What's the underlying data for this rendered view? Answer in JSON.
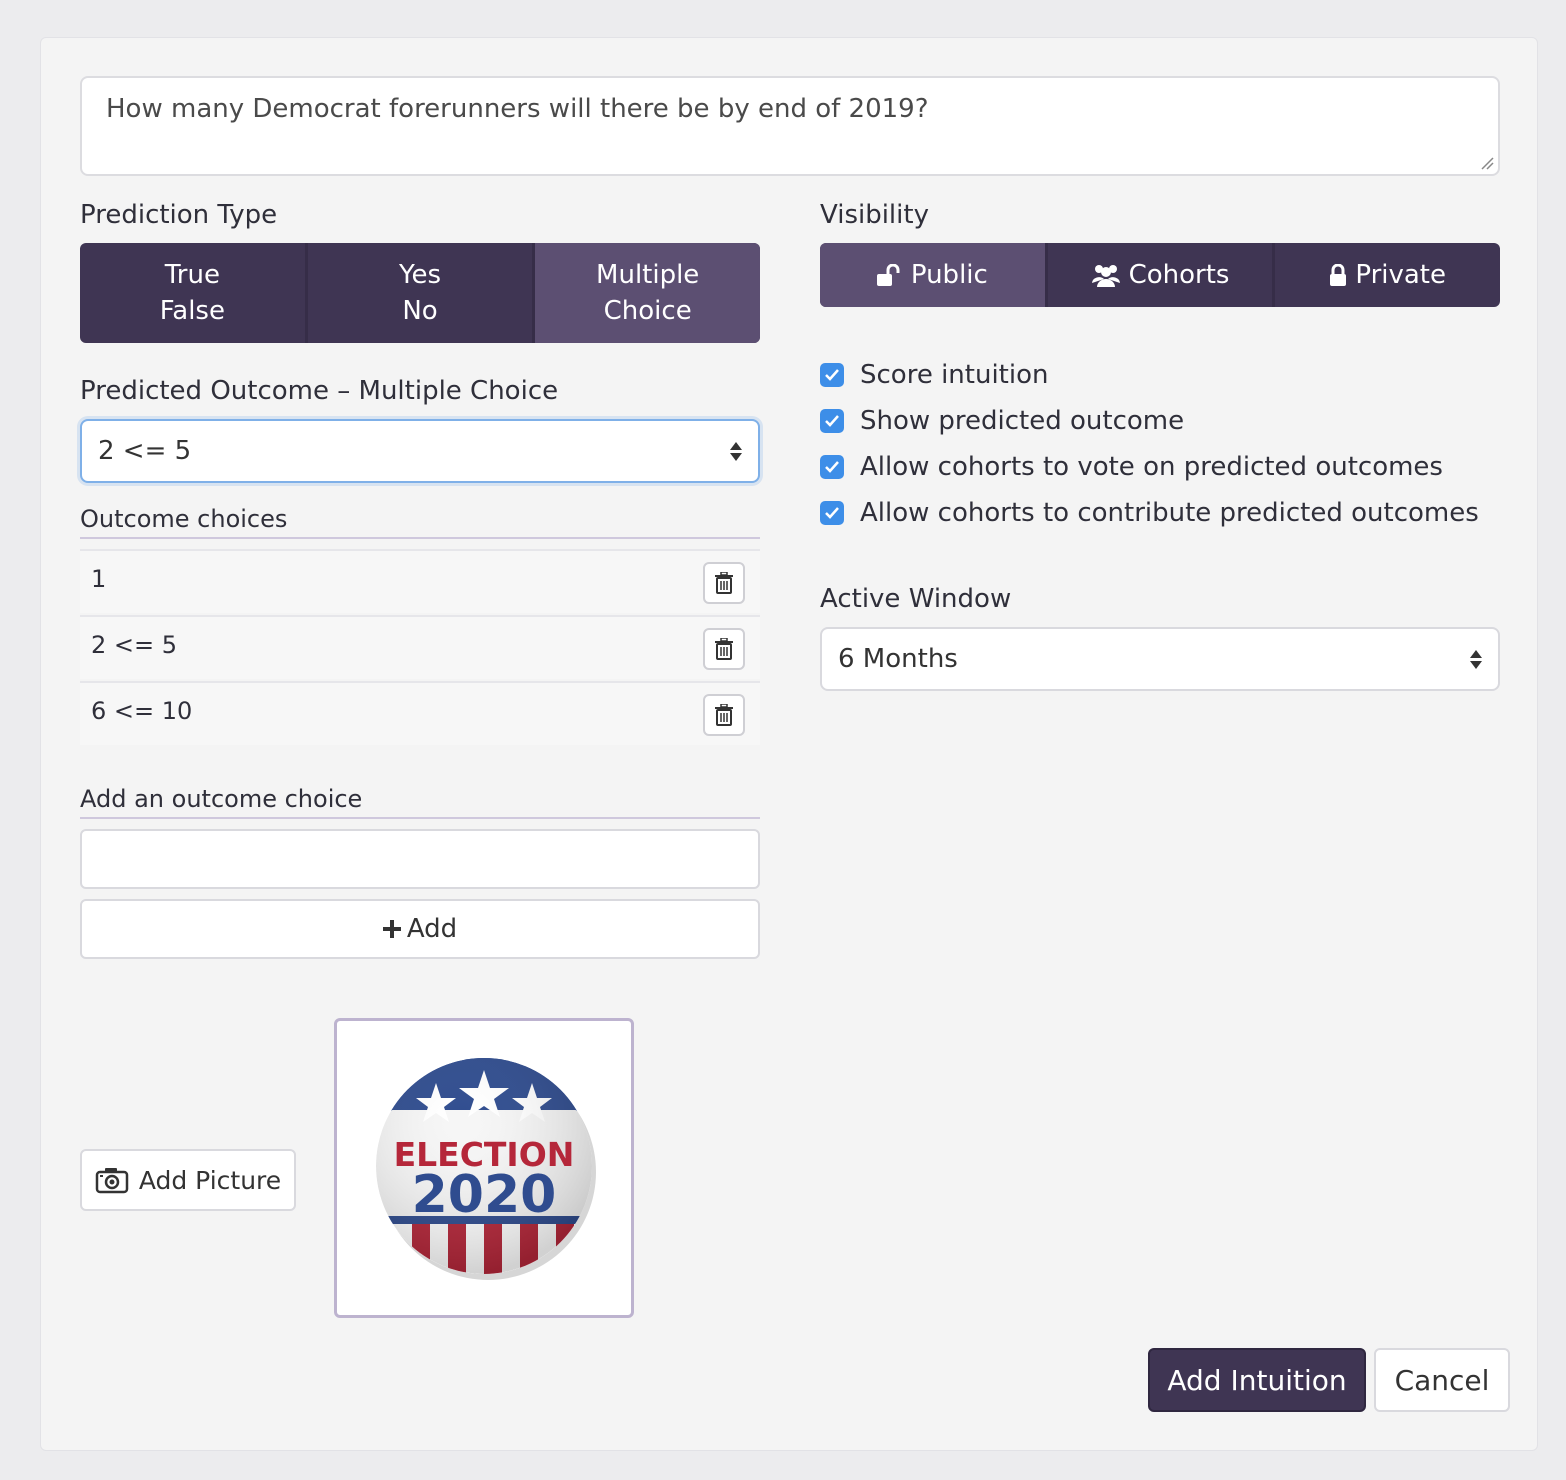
{
  "question": {
    "value": "How many Democrat forerunners will there be by end of 2019?"
  },
  "prediction_type": {
    "label": "Prediction Type",
    "options": [
      {
        "line1": "True",
        "line2": "False",
        "active": false
      },
      {
        "line1": "Yes",
        "line2": "No",
        "active": false
      },
      {
        "line1": "Multiple",
        "line2": "Choice",
        "active": true
      }
    ]
  },
  "visibility": {
    "label": "Visibility",
    "options": [
      {
        "label": "Public",
        "icon": "unlock-icon",
        "active": true
      },
      {
        "label": "Cohorts",
        "icon": "users-icon",
        "active": false
      },
      {
        "label": "Private",
        "icon": "lock-icon",
        "active": false
      }
    ]
  },
  "predicted_outcome": {
    "label": "Predicted Outcome – Multiple Choice",
    "selected": "2 <= 5"
  },
  "outcome_choices": {
    "label": "Outcome choices",
    "items": [
      "1",
      "2 <= 5",
      "6 <= 10"
    ]
  },
  "add_outcome": {
    "label": "Add an outcome choice",
    "value": "",
    "button_label": "Add"
  },
  "options": {
    "score_intuition": "Score intuition",
    "show_predicted_outcome": "Show predicted outcome",
    "allow_vote": "Allow cohorts to vote on predicted outcomes",
    "allow_contribute": "Allow cohorts to contribute predicted outcomes"
  },
  "active_window": {
    "label": "Active Window",
    "selected": "6 Months"
  },
  "picture": {
    "button_label": "Add Picture",
    "badge_line1": "ELECTION",
    "badge_line2": "2020"
  },
  "actions": {
    "submit_label": "Add Intuition",
    "cancel_label": "Cancel"
  },
  "colors": {
    "accent": "#3f3553",
    "accent_active": "#5c4f72",
    "checkbox": "#3d8ee8"
  }
}
